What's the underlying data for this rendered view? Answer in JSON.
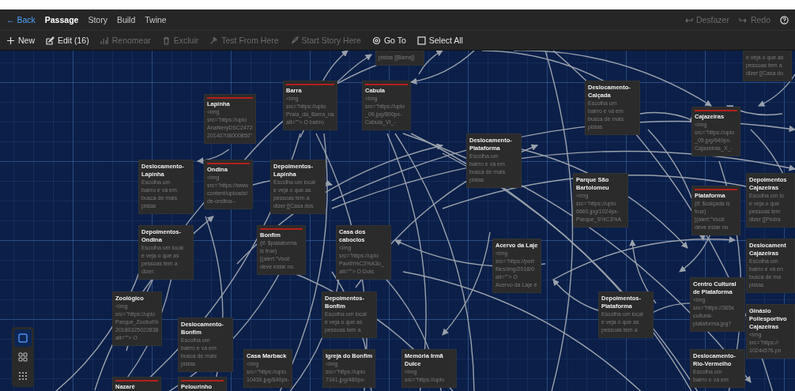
{
  "top_bar": {
    "back": "← Back",
    "tabs": [
      {
        "label": "Passage",
        "selected": true
      },
      {
        "label": "Story",
        "selected": false
      },
      {
        "label": "Build",
        "selected": false
      },
      {
        "label": "Twine",
        "selected": false
      }
    ],
    "right": [
      {
        "label": "Desfazer",
        "disabled": true
      },
      {
        "label": "Redo",
        "disabled": true
      }
    ]
  },
  "toolbar": [
    {
      "label": "New",
      "disabled": false
    },
    {
      "label": "Edit (16)",
      "disabled": false
    },
    {
      "label": "Renomear",
      "disabled": true
    },
    {
      "label": "Excluir",
      "disabled": true
    },
    {
      "label": "Test From Here",
      "disabled": true
    },
    {
      "label": "Start Story Here",
      "disabled": true
    },
    {
      "label": "Go To",
      "disabled": false
    },
    {
      "label": "Select All",
      "disabled": false
    }
  ],
  "passages": [
    {
      "excerpt": [
        "pistas [[Barra]]"
      ]
    },
    {
      "excerpt": [
        "e veja o que as",
        "pessoas tem a",
        "dizer [[Casa do"
      ]
    },
    {
      "title": "Barra",
      "color": "#b3201c",
      "excerpt": [
        "<img",
        "src=\"https://uplo",
        "Praia_da_Barra_na",
        "alt=\"\"> O bairro"
      ]
    },
    {
      "title": "Cabula",
      "color": "#b3201c",
      "excerpt": [
        "<img",
        "src=\"https://uplo",
        "_09.jpg/800px-",
        "Cabula_VI_-"
      ]
    },
    {
      "title": "Lapinha",
      "color": "#b3201c",
      "excerpt": [
        "<img",
        "src=\"https://uplo",
        "AnaNeryDSC2472",
        "20140708000850\""
      ]
    },
    {
      "title": "Deslocamento-Calçada",
      "excerpt": [
        "Escolha um",
        "bairro e vá em",
        "busca de mais",
        "pistas"
      ]
    },
    {
      "title": "Cajazeiras",
      "color": "#b3201c",
      "excerpt": [
        "<img",
        "src=\"https://uplo",
        "_05.jpg/640px-",
        "Cajazeiras_X_-"
      ]
    },
    {
      "title": "Deslocamento-Plataforma",
      "excerpt": [
        "Escolha um",
        "bairro e vá em",
        "busca de mais",
        "pistas"
      ]
    },
    {
      "title": "Deslocamento-Lapinha",
      "excerpt": [
        "Escolha um",
        "bairro e vá em",
        "busca de mais",
        "pistas"
      ]
    },
    {
      "title": "Ondina",
      "color": "#b3201c",
      "excerpt": [
        "<img",
        "src=\"https://www",
        "content/uploads/",
        "de-ondina--"
      ]
    },
    {
      "title": "Depoimentos-Lapinha",
      "excerpt": [
        "Escolha um local",
        "e veja o que as",
        "pessoas tem a",
        "dizer [[Casa dos"
      ]
    },
    {
      "title": "Parque São Bartolomeu",
      "excerpt": [
        "<img",
        "src=\"https://uplo",
        "6860.jpg/1024px-",
        "Parque_S%C3%A"
      ]
    },
    {
      "title": "Plataforma",
      "color": "#b3201c",
      "excerpt": [
        "(if: $calçada is",
        "true)",
        "[(alert:\"Você",
        "deve estar no"
      ]
    },
    {
      "title": "Depoimentos Cajazeiras",
      "excerpt": [
        "Escolha um lo",
        "e veja o que",
        "pessoas tem",
        "dizer [[Pedra"
      ]
    },
    {
      "title": "Depoimentos-Ondina",
      "excerpt": [
        "Escolha um local",
        "e veja o que as",
        "pessoas tem a",
        "dizer:"
      ]
    },
    {
      "title": "Bonfim",
      "color": "#b3201c",
      "excerpt": [
        "(if: $plataforma",
        "is true)",
        "[(alert:\"Você",
        "deve estar no"
      ]
    },
    {
      "title": "Casa dos caboclos",
      "excerpt": [
        "<img",
        "src=\"https://uplo",
        "Pavilh%C3%A3o_",
        "alt=\"\"> O Dois"
      ]
    },
    {
      "title": "Acervo da Laje",
      "excerpt": [
        "<img",
        "src=\"https://port",
        "files/img/2018/0",
        "alt=\"\"> O",
        "Acervo da Laje é"
      ]
    },
    {
      "title": "Deslocament Cajazeiras",
      "excerpt": [
        "Escolha um",
        "bairro e vá en",
        "busca de ma",
        "pistas"
      ]
    },
    {
      "title": "Zoológico",
      "excerpt": [
        "<img",
        "src=\"https://uplo",
        "Parque_Zoobot%",
        "20180325022838",
        "alt=\"\"> O"
      ]
    },
    {
      "title": "Deslocamento-Bonfim",
      "excerpt": [
        "Escolha um",
        "bairro e vá em",
        "busca de mais",
        "pistas"
      ]
    },
    {
      "title": "Depoimentos-Bonfim",
      "excerpt": [
        "Escolha um local",
        "e veja o que as",
        "pessoas tem a"
      ]
    },
    {
      "title": "Depoimentos-Plataforma",
      "excerpt": [
        "Escolha um local",
        "e veja o que as",
        "pessoas tem a"
      ]
    },
    {
      "title": "Centro Cultural de Plataforma",
      "excerpt": [
        "<img",
        "src=\"https://365s",
        "cultural-",
        "plataforma.jpg?"
      ]
    },
    {
      "title": "Ginásio Poliesportivo Cajazeiras",
      "excerpt": [
        "<img",
        "src=\"https://",
        "1024x576.pn"
      ]
    },
    {
      "title": "Casa Marback",
      "excerpt": [
        "<img",
        "src=\"https://uplo",
        "10439.jpg/640px-"
      ]
    },
    {
      "title": "Igreja do Bonfim",
      "excerpt": [
        "<img",
        "src=\"https://uplo",
        "7341.jpg/480px-"
      ]
    },
    {
      "title": "Memória Irmã Dulce",
      "excerpt": [
        "<img",
        "src=\"https://uplo"
      ]
    },
    {
      "title": "Deslocamento-Rio-Vermelho",
      "excerpt": [
        "Escolha um",
        "bairro e vá em"
      ]
    },
    {
      "title": "Nazaré",
      "color": "#b3201c"
    },
    {
      "title": "Pelourinho",
      "color": "#b3201c"
    }
  ],
  "zoom_buttons": [
    {
      "kind": "square",
      "selected": true
    },
    {
      "kind": "grid4",
      "selected": false
    },
    {
      "kind": "grid9",
      "selected": false
    }
  ]
}
